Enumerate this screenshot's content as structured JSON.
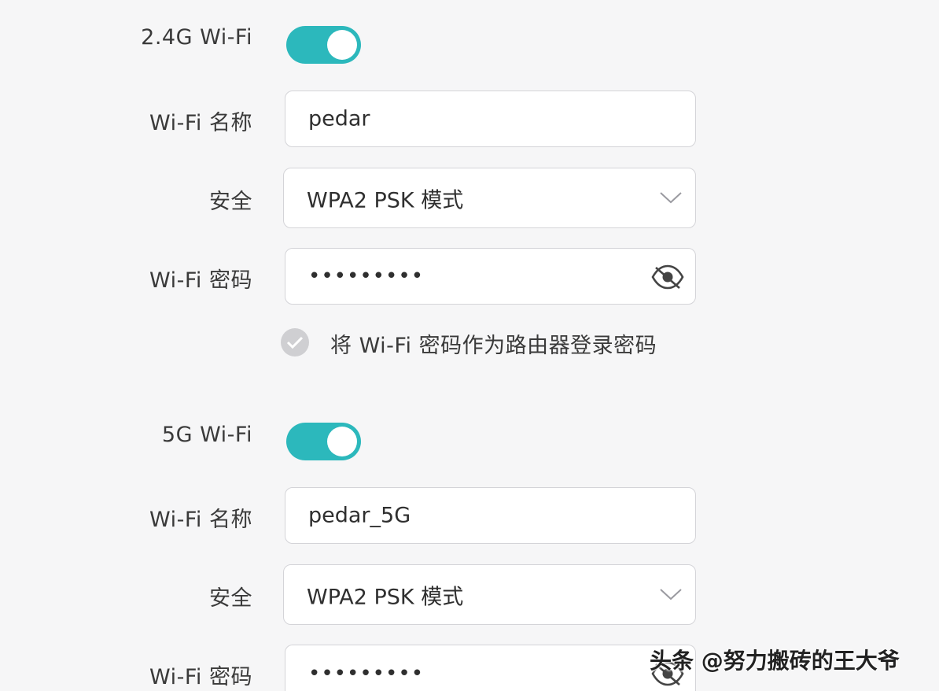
{
  "band_24g": {
    "title": "2.4G Wi-Fi",
    "enabled": true,
    "name_label": "Wi-Fi 名称",
    "name_value": "pedar",
    "security_label": "安全",
    "security_value": "WPA2 PSK 模式",
    "password_label": "Wi-Fi 密码",
    "password_value": "•••••••••",
    "use_as_login_label": "将 Wi-Fi 密码作为路由器登录密码"
  },
  "band_5g": {
    "title": "5G Wi-Fi",
    "enabled": true,
    "name_label": "Wi-Fi 名称",
    "name_value": "pedar_5G",
    "security_label": "安全",
    "security_value": "WPA2 PSK 模式",
    "password_label": "Wi-Fi 密码",
    "password_value": "•••••••••"
  },
  "watermark": "头条 @努力搬砖的王大爷",
  "icons": {
    "toggle": "toggle-on",
    "select": "chevron-down-icon",
    "password": "eye-hidden-icon",
    "checkbox": "check-icon"
  },
  "colors": {
    "accent": "#2cb8bc",
    "background": "#f6f6f7",
    "field_border": "#d4d4d8",
    "checkbox_inactive": "#cfcfd2"
  }
}
